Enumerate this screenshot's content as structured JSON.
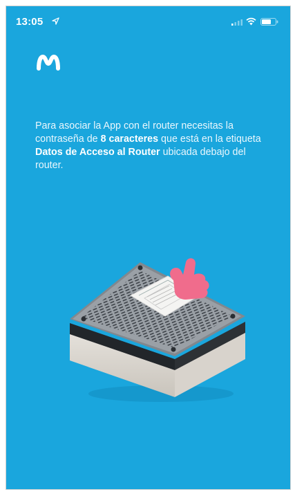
{
  "status_bar": {
    "time": "13:05",
    "icons": [
      "location-arrow-icon",
      "cellular-signal-icon",
      "wifi-icon",
      "battery-icon"
    ]
  },
  "brand": {
    "logo_icon": "movistar-m-logo-icon"
  },
  "instructions": {
    "part1": "Para asociar la App con el router necesitas la contraseña de ",
    "bold1": "8 caracteres",
    "part2": " que está en la etiqueta ",
    "bold2": "Datos de Acceso al Router",
    "part3": " ubicada debajo del router."
  },
  "illustration": {
    "icon": "router-underside-label-icon"
  },
  "colors": {
    "background": "#1aa6dd",
    "text": "#ffffff",
    "accent_hand": "#f06c8c"
  }
}
